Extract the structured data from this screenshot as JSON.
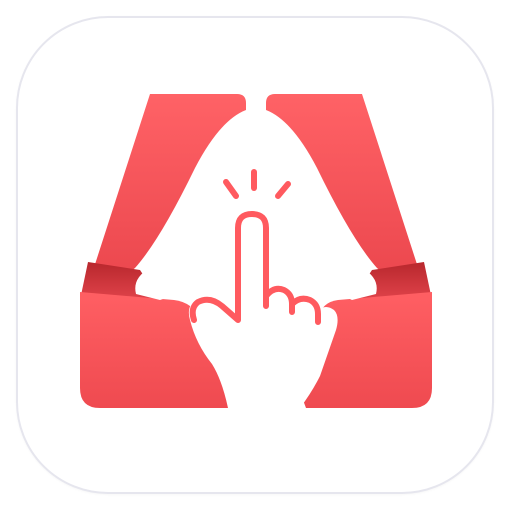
{
  "app_icon": {
    "name": "notification-bell-tap-icon",
    "colors": {
      "primary_red": "#ff5a5f",
      "mid_red": "#f24a50",
      "deep_red": "#d8343b",
      "tile_background": "#ffffff",
      "tile_border": "#e6e6ee",
      "glyph_white": "#ffffff"
    }
  }
}
